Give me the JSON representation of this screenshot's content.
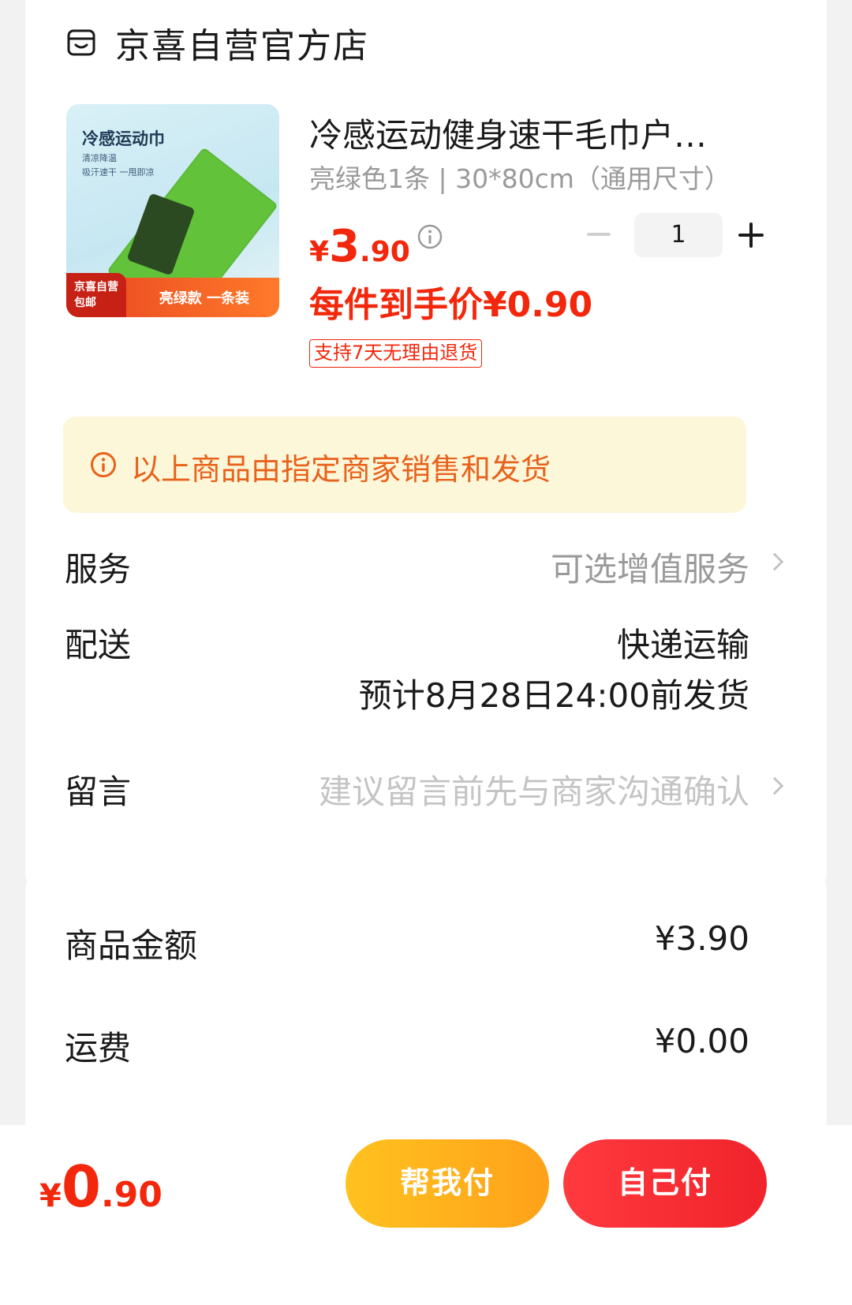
{
  "store": {
    "name": "京喜自营官方店",
    "icon": "store-icon"
  },
  "product": {
    "image": {
      "title": "冷感运动巾",
      "subtitle1": "清凉降温",
      "subtitle2": "吸汗速干 一甩即凉",
      "badge_line1": "京喜自营",
      "badge_line2": "包邮",
      "band_text": "亮绿款 一条装",
      "towel_color": "#62c23a"
    },
    "title": "冷感运动健身速干毛巾户…",
    "spec": "亮绿色1条 | 30*80cm（通用尺寸）",
    "price": {
      "currency": "¥",
      "integer": "3",
      "decimal": ".90"
    },
    "quantity": "1",
    "unit_price_text": "每件到手价¥0.90",
    "return_tag": "支持7天无理由退货"
  },
  "notice": {
    "text": "以上商品由指定商家销售和发货"
  },
  "rows": {
    "service": {
      "label": "服务",
      "value": "可选增值服务"
    },
    "delivery": {
      "label": "配送",
      "value_line1": "快递运输",
      "value_line2": "预计8月28日24:00前发货"
    },
    "message": {
      "label": "留言",
      "placeholder": "建议留言前先与商家沟通确认"
    }
  },
  "summary": {
    "goods": {
      "label": "商品金额",
      "value": "¥3.90"
    },
    "shipping": {
      "label": "运费",
      "value": "¥0.00"
    }
  },
  "footer": {
    "total": {
      "currency": "¥",
      "integer": "0",
      "decimal": ".90"
    },
    "help_pay": "帮我付",
    "self_pay": "自己付"
  },
  "colors": {
    "accent_red": "#f2270c",
    "notice_orange": "#e8621c",
    "notice_bg": "#fdf7d9",
    "btn_yellow": "#ffb31d",
    "btn_red": "#f52a31"
  }
}
